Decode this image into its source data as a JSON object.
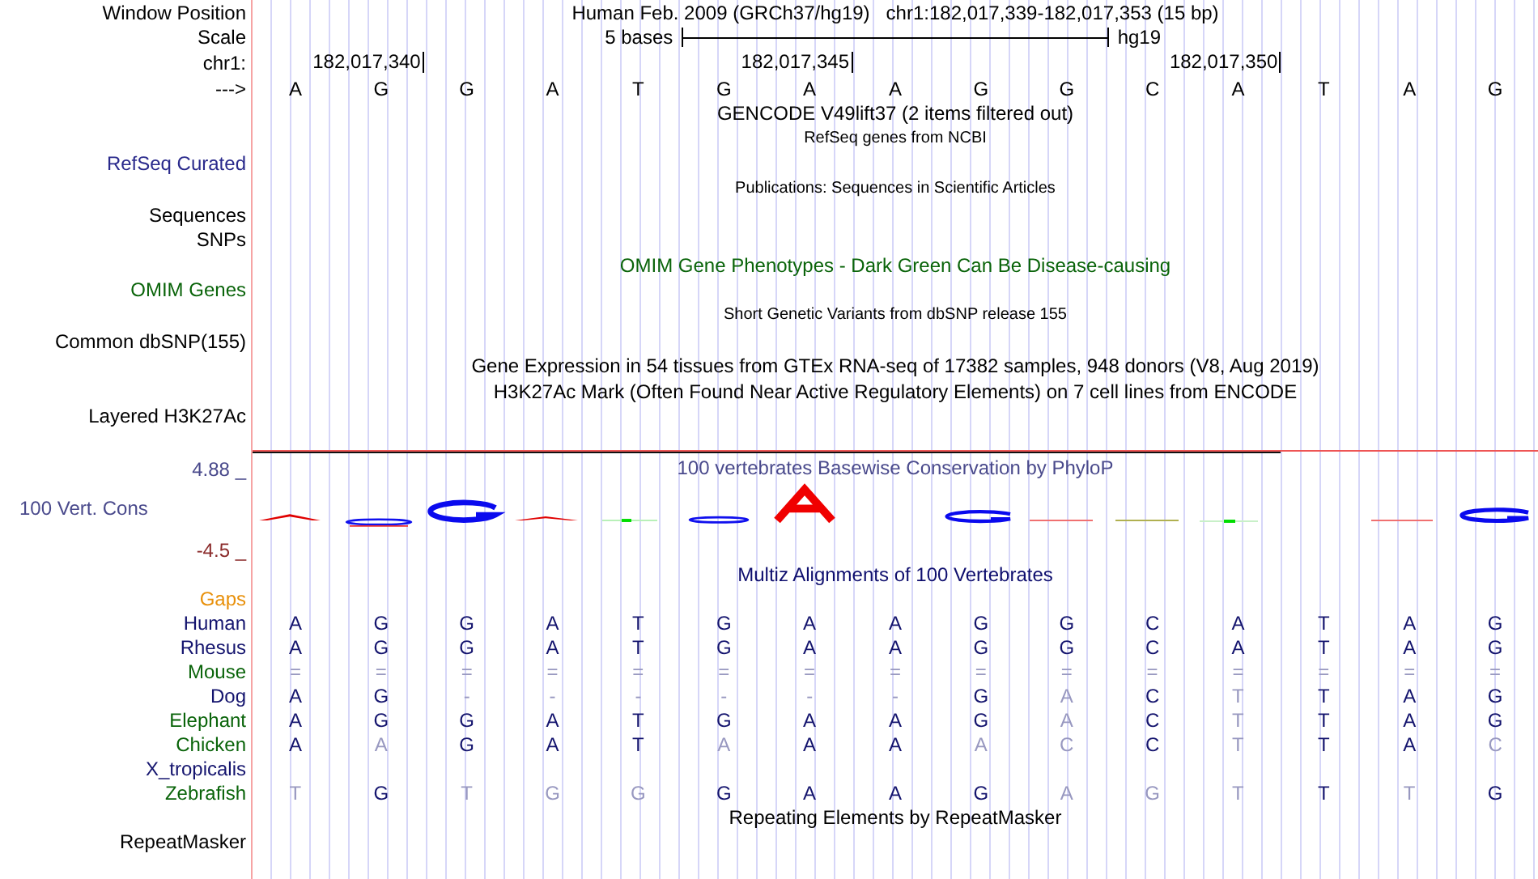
{
  "header": {
    "label": "Window Position",
    "assembly": "Human Feb. 2009 (GRCh37/hg19)",
    "position": "chr1:182,017,339-182,017,353 (15 bp)"
  },
  "scale": {
    "label": "Scale",
    "text": "5 bases",
    "assembly": "hg19"
  },
  "ruler": {
    "label": "chr1:",
    "strand": "--->",
    "sequence": [
      {
        "base": "A"
      },
      {
        "base": "G",
        "tick": "182,017,340"
      },
      {
        "base": "G"
      },
      {
        "base": "A"
      },
      {
        "base": "T"
      },
      {
        "base": "G"
      },
      {
        "base": "A",
        "tick": "182,017,345"
      },
      {
        "base": "A"
      },
      {
        "base": "G"
      },
      {
        "base": "G"
      },
      {
        "base": "C"
      },
      {
        "base": "A",
        "tick": "182,017,350"
      },
      {
        "base": "T"
      },
      {
        "base": "A"
      },
      {
        "base": "G"
      }
    ]
  },
  "upper_tracks": [
    {
      "title": {
        "text": "GENCODE V49lift37 (2 items filtered out)",
        "kind": "title",
        "color": "#000000"
      }
    },
    {
      "title": {
        "text": "RefSeq genes from NCBI",
        "kind": "caption",
        "color": "#000000"
      }
    },
    {
      "label": {
        "text": "RefSeq Curated",
        "color": "#2a2a8c"
      }
    },
    {
      "title": {
        "text": "Publications: Sequences in Scientific Articles",
        "kind": "caption",
        "color": "#000000"
      }
    },
    {
      "label": {
        "text": "Sequences",
        "color": "#000000"
      }
    },
    {
      "label": {
        "text": "SNPs",
        "color": "#000000"
      }
    },
    {
      "title": {
        "text": "OMIM Gene Phenotypes - Dark Green Can Be Disease-causing",
        "kind": "title",
        "color": "#0a640a"
      }
    },
    {
      "label": {
        "text": "OMIM Genes",
        "color": "#0a640a"
      }
    },
    {
      "title": {
        "text": "Short Genetic Variants from dbSNP release 155",
        "kind": "caption",
        "color": "#000000"
      }
    },
    {
      "label": {
        "text": "Common dbSNP(155)",
        "color": "#000000"
      }
    },
    {
      "title": {
        "text": "Gene Expression in 54 tissues from GTEx RNA-seq of 17382 samples, 948 donors (V8, Aug 2019)",
        "kind": "title",
        "color": "#000000"
      }
    },
    {
      "title": {
        "text": "H3K27Ac Mark (Often Found Near Active Regulatory Elements) on 7 cell lines from ENCODE",
        "kind": "title",
        "color": "#000000"
      }
    },
    {
      "label": {
        "text": "Layered H3K27Ac",
        "color": "#000000"
      }
    }
  ],
  "conservation": {
    "title": "100 vertebrates Basewise Conservation by PhyloP",
    "label": "100 Vert. Cons",
    "max": "4.88 _",
    "min": "-4.5 _"
  },
  "alignment": {
    "title": "Multiz Alignments of 100 Vertebrates",
    "gaps_label": "Gaps",
    "species": [
      {
        "name": "Human",
        "color": "#14146e",
        "bases": [
          {
            "base": "A",
            "match": true
          },
          {
            "base": "G",
            "match": true
          },
          {
            "base": "G",
            "match": true
          },
          {
            "base": "A",
            "match": true
          },
          {
            "base": "T",
            "match": true
          },
          {
            "base": "G",
            "match": true
          },
          {
            "base": "A",
            "match": true
          },
          {
            "base": "A",
            "match": true
          },
          {
            "base": "G",
            "match": true
          },
          {
            "base": "G",
            "match": true
          },
          {
            "base": "C",
            "match": true
          },
          {
            "base": "A",
            "match": true
          },
          {
            "base": "T",
            "match": true
          },
          {
            "base": "A",
            "match": true
          },
          {
            "base": "G",
            "match": true
          }
        ]
      },
      {
        "name": "Rhesus",
        "color": "#14146e",
        "bases": [
          {
            "base": "A",
            "match": true
          },
          {
            "base": "G",
            "match": true
          },
          {
            "base": "G",
            "match": true
          },
          {
            "base": "A",
            "match": true
          },
          {
            "base": "T",
            "match": true
          },
          {
            "base": "G",
            "match": true
          },
          {
            "base": "A",
            "match": true
          },
          {
            "base": "A",
            "match": true
          },
          {
            "base": "G",
            "match": true
          },
          {
            "base": "G",
            "match": true
          },
          {
            "base": "C",
            "match": true
          },
          {
            "base": "A",
            "match": true
          },
          {
            "base": "T",
            "match": true
          },
          {
            "base": "A",
            "match": true
          },
          {
            "base": "G",
            "match": true
          }
        ]
      },
      {
        "name": "Mouse",
        "color": "#0a640a",
        "bases": [
          {
            "base": "=",
            "match": false
          },
          {
            "base": "=",
            "match": false
          },
          {
            "base": "=",
            "match": false
          },
          {
            "base": "=",
            "match": false
          },
          {
            "base": "=",
            "match": false
          },
          {
            "base": "=",
            "match": false
          },
          {
            "base": "=",
            "match": false
          },
          {
            "base": "=",
            "match": false
          },
          {
            "base": "=",
            "match": false
          },
          {
            "base": "=",
            "match": false
          },
          {
            "base": "=",
            "match": false
          },
          {
            "base": "=",
            "match": false
          },
          {
            "base": "=",
            "match": false
          },
          {
            "base": "=",
            "match": false
          },
          {
            "base": "=",
            "match": false
          }
        ]
      },
      {
        "name": "Dog",
        "color": "#14146e",
        "bases": [
          {
            "base": "A",
            "match": true
          },
          {
            "base": "G",
            "match": true
          },
          {
            "base": "-",
            "match": false
          },
          {
            "base": "-",
            "match": false
          },
          {
            "base": "-",
            "match": false
          },
          {
            "base": "-",
            "match": false
          },
          {
            "base": "-",
            "match": false
          },
          {
            "base": "-",
            "match": false
          },
          {
            "base": "G",
            "match": true
          },
          {
            "base": "A",
            "match": false
          },
          {
            "base": "C",
            "match": true
          },
          {
            "base": "T",
            "match": false
          },
          {
            "base": "T",
            "match": true
          },
          {
            "base": "A",
            "match": true
          },
          {
            "base": "G",
            "match": true
          }
        ]
      },
      {
        "name": "Elephant",
        "color": "#0a640a",
        "bases": [
          {
            "base": "A",
            "match": true
          },
          {
            "base": "G",
            "match": true
          },
          {
            "base": "G",
            "match": true
          },
          {
            "base": "A",
            "match": true
          },
          {
            "base": "T",
            "match": true
          },
          {
            "base": "G",
            "match": true
          },
          {
            "base": "A",
            "match": true
          },
          {
            "base": "A",
            "match": true
          },
          {
            "base": "G",
            "match": true
          },
          {
            "base": "A",
            "match": false
          },
          {
            "base": "C",
            "match": true
          },
          {
            "base": "T",
            "match": false
          },
          {
            "base": "T",
            "match": true
          },
          {
            "base": "A",
            "match": true
          },
          {
            "base": "G",
            "match": true
          }
        ]
      },
      {
        "name": "Chicken",
        "color": "#0a640a",
        "bases": [
          {
            "base": "A",
            "match": true
          },
          {
            "base": "A",
            "match": false
          },
          {
            "base": "G",
            "match": true
          },
          {
            "base": "A",
            "match": true
          },
          {
            "base": "T",
            "match": true
          },
          {
            "base": "A",
            "match": false
          },
          {
            "base": "A",
            "match": true
          },
          {
            "base": "A",
            "match": true
          },
          {
            "base": "A",
            "match": false
          },
          {
            "base": "C",
            "match": false
          },
          {
            "base": "C",
            "match": true
          },
          {
            "base": "T",
            "match": false
          },
          {
            "base": "T",
            "match": true
          },
          {
            "base": "A",
            "match": true
          },
          {
            "base": "C",
            "match": false
          }
        ]
      },
      {
        "name": "X_tropicalis",
        "color": "#14146e"
      },
      {
        "name": "Zebrafish",
        "color": "#0a640a",
        "bases": [
          {
            "base": "T",
            "match": false
          },
          {
            "base": "G",
            "match": true
          },
          {
            "base": "T",
            "match": false
          },
          {
            "base": "G",
            "match": false
          },
          {
            "base": "G",
            "match": false
          },
          {
            "base": "G",
            "match": true
          },
          {
            "base": "A",
            "match": true
          },
          {
            "base": "A",
            "match": true
          },
          {
            "base": "G",
            "match": true
          },
          {
            "base": "A",
            "match": false
          },
          {
            "base": "G",
            "match": false
          },
          {
            "base": "T",
            "match": false
          },
          {
            "base": "T",
            "match": true
          },
          {
            "base": "T",
            "match": false
          },
          {
            "base": "G",
            "match": true
          }
        ]
      }
    ]
  },
  "lower_tracks": [
    {
      "title": {
        "text": "Repeating Elements by RepeatMasker",
        "kind": "title",
        "color": "#000000"
      }
    },
    {
      "label": {
        "text": "RepeatMasker",
        "color": "#000000"
      }
    }
  ]
}
